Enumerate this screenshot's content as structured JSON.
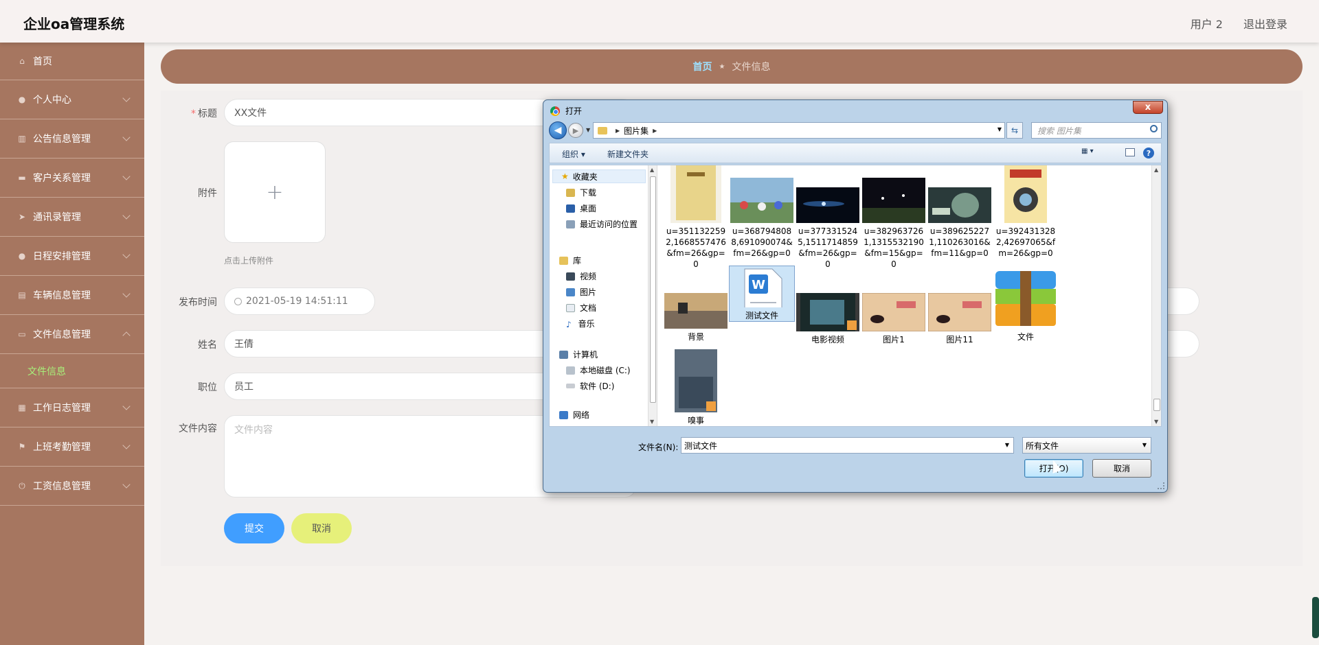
{
  "header": {
    "title": "企业oa管理系统",
    "user": "用户 2",
    "logout": "退出登录"
  },
  "sidebar": {
    "items": [
      {
        "label": "首页",
        "icon": "home-icon"
      },
      {
        "label": "个人中心",
        "icon": "user-icon"
      },
      {
        "label": "公告信息管理",
        "icon": "chart-icon"
      },
      {
        "label": "客户关系管理",
        "icon": "monitor-icon"
      },
      {
        "label": "通讯录管理",
        "icon": "send-icon"
      },
      {
        "label": "日程安排管理",
        "icon": "person-icon"
      },
      {
        "label": "车辆信息管理",
        "icon": "bank-icon"
      },
      {
        "label": "文件信息管理",
        "icon": "message-icon"
      },
      {
        "label": "工作日志管理",
        "icon": "grid-icon"
      },
      {
        "label": "上班考勤管理",
        "icon": "flag-icon"
      },
      {
        "label": "工资信息管理",
        "icon": "power-icon"
      }
    ],
    "sub_item": "文件信息"
  },
  "breadcrumb": {
    "home": "首页",
    "current": "文件信息"
  },
  "form": {
    "title_label": "标题",
    "title_value": "XX文件",
    "attachment_label": "附件",
    "upload_hint": "点击上传附件",
    "time_label": "发布时间",
    "time_value": "2021-05-19 14:51:11",
    "name_label": "姓名",
    "name_value": "王倩",
    "position_label": "职位",
    "position_value": "员工",
    "content_label": "文件内容",
    "content_placeholder": "文件内容",
    "submit": "提交",
    "cancel": "取消"
  },
  "dialog": {
    "title": "打开",
    "close": "x",
    "path": "图片集",
    "search_placeholder": "搜索 图片集",
    "toolbar": {
      "organize": "组织 ▾",
      "new_folder": "新建文件夹",
      "help": "?"
    },
    "nav": {
      "favorites": "收藏夹",
      "downloads": "下载",
      "desktop": "桌面",
      "recent": "最近访问的位置",
      "libraries": "库",
      "videos": "视频",
      "pictures": "图片",
      "documents": "文档",
      "music": "音乐",
      "computer": "计算机",
      "drive_c": "本地磁盘 (C:)",
      "drive_d": "软件 (D:)",
      "network": "网络"
    },
    "files": [
      "u=3511322592,1668557476&fm=26&gp=0",
      "u=3687948088,691090074&fm=26&gp=0",
      "u=3773315245,1511714859&fm=26&gp=0",
      "u=3829637261,1315532190&fm=15&gp=0",
      "u=3896252271,110263016&fm=11&gp=0",
      "u=3924313282,42697065&fm=26&gp=0",
      "背景",
      "测试文件",
      "电影视频",
      "图片1",
      "图片11",
      "文件",
      "嗅事"
    ],
    "filename_label": "文件名(N):",
    "filename_value": "测试文件",
    "filetype_value": "所有文件",
    "open_button": "打开(O)",
    "cancel_button": "取消"
  }
}
